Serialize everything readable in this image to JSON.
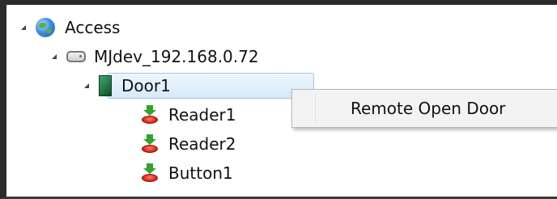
{
  "tree": {
    "root": {
      "label": "Access",
      "icon": "globe-icon"
    },
    "device": {
      "label": "MJdev_192.168.0.72",
      "icon": "device-icon"
    },
    "door": {
      "label": "Door1",
      "icon": "door-icon",
      "selected": true
    },
    "children": [
      {
        "label": "Reader1",
        "icon": "reader-icon"
      },
      {
        "label": "Reader2",
        "icon": "reader-icon"
      },
      {
        "label": "Button1",
        "icon": "reader-icon"
      }
    ]
  },
  "context_menu": {
    "items": [
      {
        "label": "Remote Open Door"
      }
    ]
  },
  "colors": {
    "selection_bg": "#d7e9fb",
    "selection_border": "#9ec4ee",
    "menu_bg": "#f3f3f3"
  }
}
